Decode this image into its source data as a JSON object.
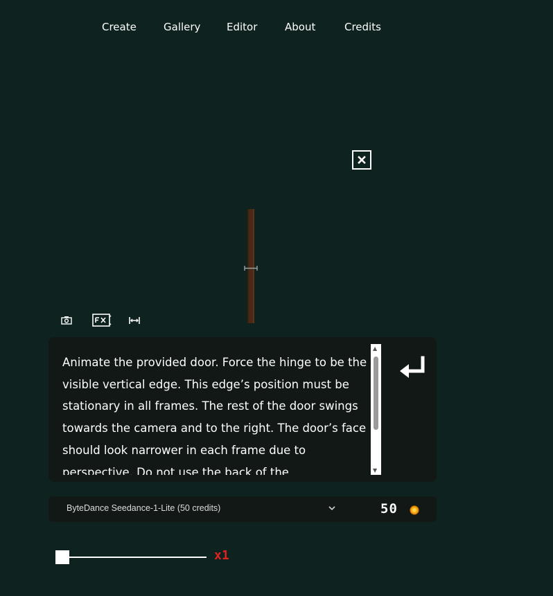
{
  "nav": {
    "items": [
      "Create",
      "Gallery",
      "Editor",
      "About",
      "Credits"
    ]
  },
  "canvas": {
    "close_icon": "close-icon",
    "door_color": "#4a2a17"
  },
  "toolbar": {
    "icons": [
      "camera-icon",
      "video-fx-icon",
      "resize-icon"
    ]
  },
  "prompt": {
    "text": "Animate the provided door. Force the hinge to be the visible vertical edge. This edge’s position must be stationary in all frames. The rest of the door swings towards the camera and to the right. The door’s face should look narrower in each frame due to perspective. Do not use the back of the",
    "submit_icon": "enter-icon"
  },
  "model": {
    "selected": "ByteDance Seedance-1-Lite (50 credits)",
    "credits": "50",
    "coin_icon": "coin-icon"
  },
  "slider": {
    "label": "x1",
    "value": 1,
    "color": "#e0231f"
  }
}
